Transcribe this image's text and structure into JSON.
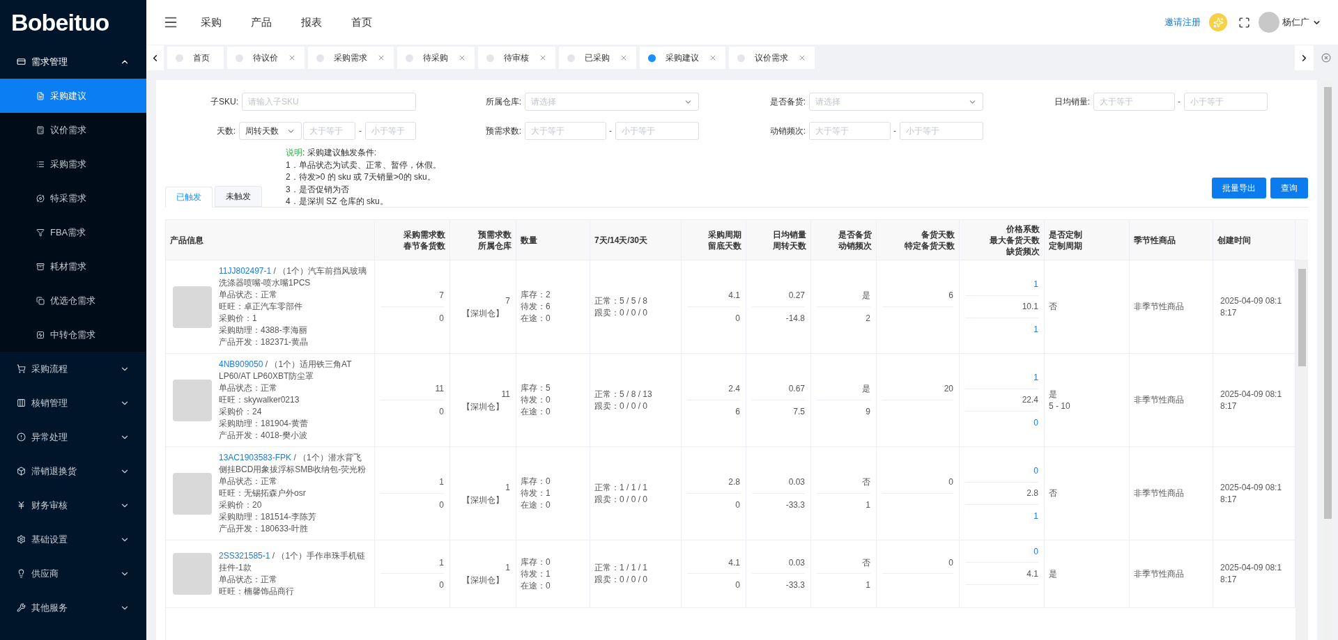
{
  "logo": "Bobeituo",
  "header": {
    "nav": [
      "采购",
      "产品",
      "报表",
      "首页"
    ],
    "invite": "邀请注册",
    "user": "杨仁广"
  },
  "sidebar": [
    {
      "label": "需求管理",
      "expanded": true,
      "children": [
        {
          "label": "采购建议",
          "selected": true
        },
        {
          "label": "议价需求",
          "selected": false
        },
        {
          "label": "采购需求",
          "selected": false
        },
        {
          "label": "特采需求",
          "selected": false
        },
        {
          "label": "FBA需求",
          "selected": false
        },
        {
          "label": "耗材需求",
          "selected": false
        },
        {
          "label": "优选仓需求",
          "selected": false
        },
        {
          "label": "中转仓需求",
          "selected": false
        }
      ]
    },
    {
      "label": "采购流程",
      "expanded": false
    },
    {
      "label": "核销管理",
      "expanded": false
    },
    {
      "label": "异常处理",
      "expanded": false
    },
    {
      "label": "滞销退换货",
      "expanded": false
    },
    {
      "label": "财务审核",
      "expanded": false
    },
    {
      "label": "基础设置",
      "expanded": false
    },
    {
      "label": "供应商",
      "expanded": false
    },
    {
      "label": "其他服务",
      "expanded": false
    }
  ],
  "page_tabs": [
    {
      "label": "首页",
      "selected": false,
      "closable": false
    },
    {
      "label": "待议价",
      "selected": false,
      "closable": true
    },
    {
      "label": "采购需求",
      "selected": false,
      "closable": true
    },
    {
      "label": "待采购",
      "selected": false,
      "closable": true
    },
    {
      "label": "待审核",
      "selected": false,
      "closable": true
    },
    {
      "label": "已采购",
      "selected": false,
      "closable": true
    },
    {
      "label": "采购建议",
      "selected": true,
      "closable": true
    },
    {
      "label": "议价需求",
      "selected": false,
      "closable": true
    }
  ],
  "filters": [
    [
      {
        "label": "子SKU:",
        "kind": "text",
        "placeholder": "请输入子SKU"
      },
      {
        "label": "所属仓库:",
        "kind": "select",
        "placeholder": "请选择"
      },
      {
        "label": "是否备货:",
        "kind": "select",
        "placeholder": "请选择"
      },
      {
        "label": "日均销量:",
        "kind": "range",
        "placeholders": [
          "大于等于",
          "小于等于"
        ],
        "separator": "-"
      }
    ],
    [
      {
        "label": "天数:",
        "kind": "select-range",
        "value": "周转天数",
        "placeholders": [
          "大于等于",
          "小于等于"
        ],
        "separator": "-"
      },
      {
        "label": "预需求数:",
        "kind": "range",
        "placeholders": [
          "大于等于",
          "小于等于"
        ],
        "separator": "-"
      },
      {
        "label": "动销频次:",
        "kind": "range",
        "placeholders": [
          "大于等于",
          "小于等于"
        ],
        "separator": "-"
      }
    ]
  ],
  "notes": {
    "label": "说明",
    "text": ": 采购建议触发条件:",
    "items": [
      "1．单品状态为试卖、正常、暂停，休假。",
      "2．待发>0 的 sku 或 7天销量>0的 sku。",
      "3．是否促销为否",
      "4．是深圳 SZ 仓库的 sku。"
    ]
  },
  "result_tabs": [
    {
      "label": "已触发",
      "selected": true
    },
    {
      "label": "未触发",
      "selected": false
    }
  ],
  "buttons": [
    "批量导出",
    "查询"
  ],
  "table": {
    "product_header": [
      "产品信息"
    ],
    "columns": [
      {
        "kind": "stack",
        "lines": [
          "采购需求数",
          "春节备货数"
        ]
      },
      {
        "kind": "warehouse",
        "lines": [
          "预需求数",
          "所属仓库"
        ]
      },
      {
        "kind": "plain",
        "lines": [
          "数量"
        ]
      },
      {
        "kind": "plain",
        "lines": [
          "7天/14天/30天"
        ]
      },
      {
        "kind": "stack",
        "lines": [
          "采购周期",
          "留底天数"
        ]
      },
      {
        "kind": "stack",
        "lines": [
          "日均销量",
          "周转天数"
        ]
      },
      {
        "kind": "stack",
        "lines": [
          "是否备货",
          "动销频次"
        ]
      },
      {
        "kind": "stack",
        "lines": [
          "备货天数",
          "特定备货天数"
        ]
      },
      {
        "kind": "stack-linked",
        "lines": [
          "价格系数",
          "最大备货天数",
          "缺货频次"
        ]
      },
      {
        "kind": "plain",
        "lines": [
          "是否定制",
          "定制周期"
        ]
      },
      {
        "kind": "plain",
        "lines": [
          "季节性商品"
        ]
      },
      {
        "kind": "time",
        "lines": [
          "创建时间"
        ]
      }
    ],
    "rows": [
      {
        "sku": "11JJ802497-1",
        "title": "/ （1个）汽车前挡风玻璃洗涤器喷嘴-喷水嘴1PCS",
        "details": [
          "单品状态：正常",
          "旺旺：卓正汽车零部件",
          "采购价：1",
          "采购助理：4388-李海丽",
          "产品开发：182371-黄晶"
        ],
        "cells": [
          [
            "7",
            "0"
          ],
          [
            "7",
            "【深圳仓】"
          ],
          [
            "库存：2",
            "待发：6",
            "在途：0"
          ],
          [
            "正常：5 / 5 / 8",
            "跟卖：0 / 0 / 0"
          ],
          [
            "4.1",
            "0"
          ],
          [
            "0.27",
            "-14.8"
          ],
          [
            "是",
            "2"
          ],
          [
            "6"
          ],
          [
            "1",
            "10.1",
            "1"
          ],
          [
            "否"
          ],
          [
            "非季节性商品"
          ],
          [
            "2025-04-09 08:18:17"
          ]
        ]
      },
      {
        "sku": "4NB909050",
        "title": "/ （1个）适用铁三角AT LP60/AT LP60XBT防尘罩",
        "details": [
          "单品状态：正常",
          "旺旺：skywalker0213",
          "采购价：24",
          "采购助理：181904-黄蕾",
          "产品开发：4018-樊小波"
        ],
        "cells": [
          [
            "11",
            "0"
          ],
          [
            "11",
            "【深圳仓】"
          ],
          [
            "库存：5",
            "待发：0",
            "在途：0"
          ],
          [
            "正常：5 / 8 / 13",
            "跟卖：0 / 0 / 0"
          ],
          [
            "2.4",
            "6"
          ],
          [
            "0.67",
            "7.5"
          ],
          [
            "是",
            "9"
          ],
          [
            "20"
          ],
          [
            "1",
            "22.4",
            "0"
          ],
          [
            "是",
            "5 - 10"
          ],
          [
            "非季节性商品"
          ],
          [
            "2025-04-09 08:18:17"
          ]
        ]
      },
      {
        "sku": "13AC1903583-FPK",
        "title": "/ （1个）潜水背飞侧挂BCD用象拔浮标SMB收纳包-荧光粉",
        "details": [
          "单品状态：正常",
          "旺旺：无锡拓森户外osr",
          "采购价：20",
          "采购助理：181514-李陈芳",
          "产品开发：180633-叶胜"
        ],
        "cells": [
          [
            "1",
            "0"
          ],
          [
            "1",
            "【深圳仓】"
          ],
          [
            "库存：0",
            "待发：1",
            "在途：0"
          ],
          [
            "正常：1 / 1 / 1",
            "跟卖：0 / 0 / 0"
          ],
          [
            "2.8",
            "0"
          ],
          [
            "0.03",
            "-33.3"
          ],
          [
            "否",
            "1"
          ],
          [
            "0"
          ],
          [
            "0",
            "2.8",
            "1"
          ],
          [
            "否"
          ],
          [
            "非季节性商品"
          ],
          [
            "2025-04-09 08:18:17"
          ]
        ]
      },
      {
        "sku": "2SS321585-1",
        "title": "/ （1个）手作串珠手机链挂件-1款",
        "details": [
          "单品状态：正常",
          "旺旺：楠馨饰品商行"
        ],
        "cells": [
          [
            "1",
            "0"
          ],
          [
            "1",
            "【深圳仓】"
          ],
          [
            "库存：0",
            "待发：1",
            "在途：0"
          ],
          [
            "正常：1 / 1 / 1",
            "跟卖：0 / 0 / 0"
          ],
          [
            "4.1",
            "0"
          ],
          [
            "0.03",
            "-33.3"
          ],
          [
            "否",
            "1"
          ],
          [
            "0"
          ],
          [
            "0",
            "4.1"
          ],
          [
            "是"
          ],
          [
            "非季节性商品"
          ],
          [
            "2025-04-09 08:18:17"
          ]
        ]
      }
    ]
  }
}
